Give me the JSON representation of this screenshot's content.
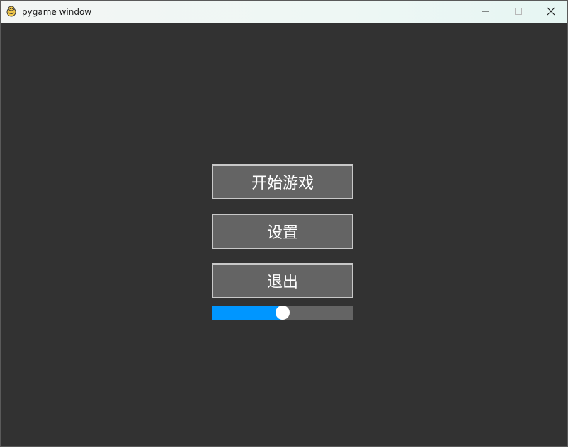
{
  "window": {
    "title": "pygame window",
    "icon": "pygame-snake-icon",
    "controls": {
      "minimize_icon": "minimize-icon",
      "maximize_icon": "maximize-icon",
      "close_icon": "close-icon"
    }
  },
  "menu": {
    "start_label": "开始游戏",
    "settings_label": "设置",
    "quit_label": "退出"
  },
  "slider": {
    "value": 0.5,
    "fill_color": "#0096ff",
    "track_color": "#646464",
    "knob_color": "#ffffff"
  },
  "colors": {
    "background": "#323232",
    "button_fill": "#646464",
    "button_border": "#c8c8c8",
    "button_text": "#ffffff"
  }
}
